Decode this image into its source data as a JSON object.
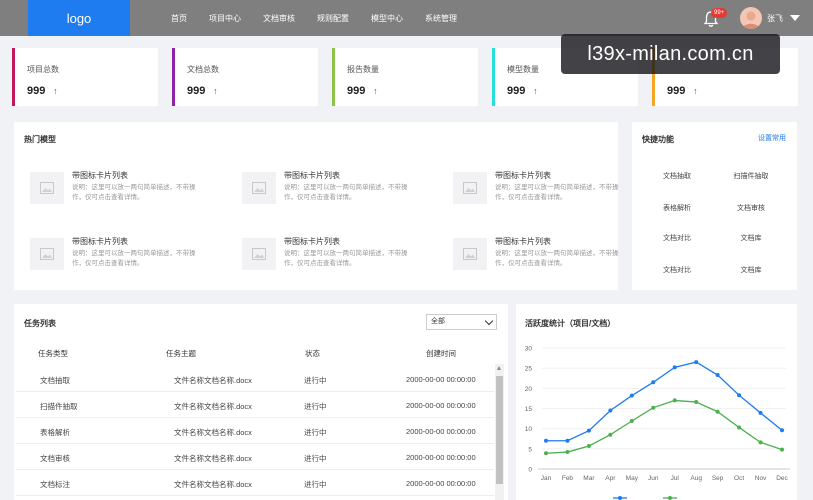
{
  "header": {
    "logo": "logo",
    "nav": [
      "首页",
      "项目中心",
      "文档审核",
      "规则配置",
      "模型中心",
      "系统管理"
    ],
    "badge": "99+",
    "user_name": "张飞"
  },
  "watermark": "l39x-milan.com.cn",
  "stats": [
    {
      "title": "项目总数",
      "value": "999",
      "arrow": "↑",
      "color": "#c2185b"
    },
    {
      "title": "文档总数",
      "value": "999",
      "arrow": "↑",
      "color": "#8e24aa"
    },
    {
      "title": "报告数量",
      "value": "999",
      "arrow": "↑",
      "color": "#8bc34a"
    },
    {
      "title": "模型数量",
      "value": "999",
      "arrow": "↑",
      "color": "#26e0e0"
    },
    {
      "title": "",
      "value": "999",
      "arrow": "↑",
      "color": "#f5a623"
    }
  ],
  "hot_models": {
    "title": "热门模型",
    "items": [
      {
        "title": "带图标卡片列表",
        "desc": "说明：这里可以放一两句简单描述，不带操作，仅可点击查看详情。"
      },
      {
        "title": "带图标卡片列表",
        "desc": "说明：这里可以放一两句简单描述，不带操作，仅可点击查看详情。"
      },
      {
        "title": "带图标卡片列表",
        "desc": "说明：这里可以放一两句简单描述，不带操作，仅可点击查看详情。"
      },
      {
        "title": "带图标卡片列表",
        "desc": "说明：这里可以放一两句简单描述，不带操作，仅可点击查看详情。"
      },
      {
        "title": "带图标卡片列表",
        "desc": "说明：这里可以放一两句简单描述，不带操作，仅可点击查看详情。"
      },
      {
        "title": "带图标卡片列表",
        "desc": "说明：这里可以放一两句简单描述，不带操作，仅可点击查看详情。"
      }
    ]
  },
  "quick": {
    "title": "快捷功能",
    "link": "设置常用",
    "items": [
      "文档抽取",
      "扫描件抽取",
      "表格解析",
      "文档审核",
      "文档对比",
      "文档库",
      "文档对比",
      "文档库"
    ]
  },
  "tasks": {
    "title": "任务列表",
    "filter": "全部",
    "columns": [
      "任务类型",
      "任务主题",
      "状态",
      "创建时间"
    ],
    "rows": [
      [
        "文档抽取",
        "文件名称文档名称.docx",
        "进行中",
        "2000-00-00 00:00:00"
      ],
      [
        "扫描件抽取",
        "文件名称文档名称.docx",
        "进行中",
        "2000-00-00 00:00:00"
      ],
      [
        "表格解析",
        "文件名称文档名称.docx",
        "进行中",
        "2000-00-00 00:00:00"
      ],
      [
        "文档审核",
        "文件名称文档名称.docx",
        "进行中",
        "2000-00-00 00:00:00"
      ],
      [
        "文档标注",
        "文件名称文档名称.docx",
        "进行中",
        "2000-00-00 00:00:00"
      ]
    ]
  },
  "chart_data": {
    "type": "line",
    "title": "活跃度统计（项目/文档）",
    "categories": [
      "Jan",
      "Feb",
      "Mar",
      "Apr",
      "May",
      "Jun",
      "Jul",
      "Aug",
      "Sep",
      "Oct",
      "Nov",
      "Dec"
    ],
    "ylim": [
      0,
      30
    ],
    "yticks": [
      0,
      5,
      10,
      15,
      20,
      25,
      30
    ],
    "series": [
      {
        "name": "",
        "color": "#1e7bf0",
        "values": [
          7,
          7,
          9.5,
          14.5,
          18.2,
          21.5,
          25.2,
          26.5,
          23.3,
          18.3,
          13.9,
          9.6
        ]
      },
      {
        "name": "",
        "color": "#4caf50",
        "values": [
          3.9,
          4.2,
          5.7,
          8.5,
          11.9,
          15.2,
          17,
          16.6,
          14.2,
          10.3,
          6.6,
          4.8
        ]
      }
    ]
  }
}
